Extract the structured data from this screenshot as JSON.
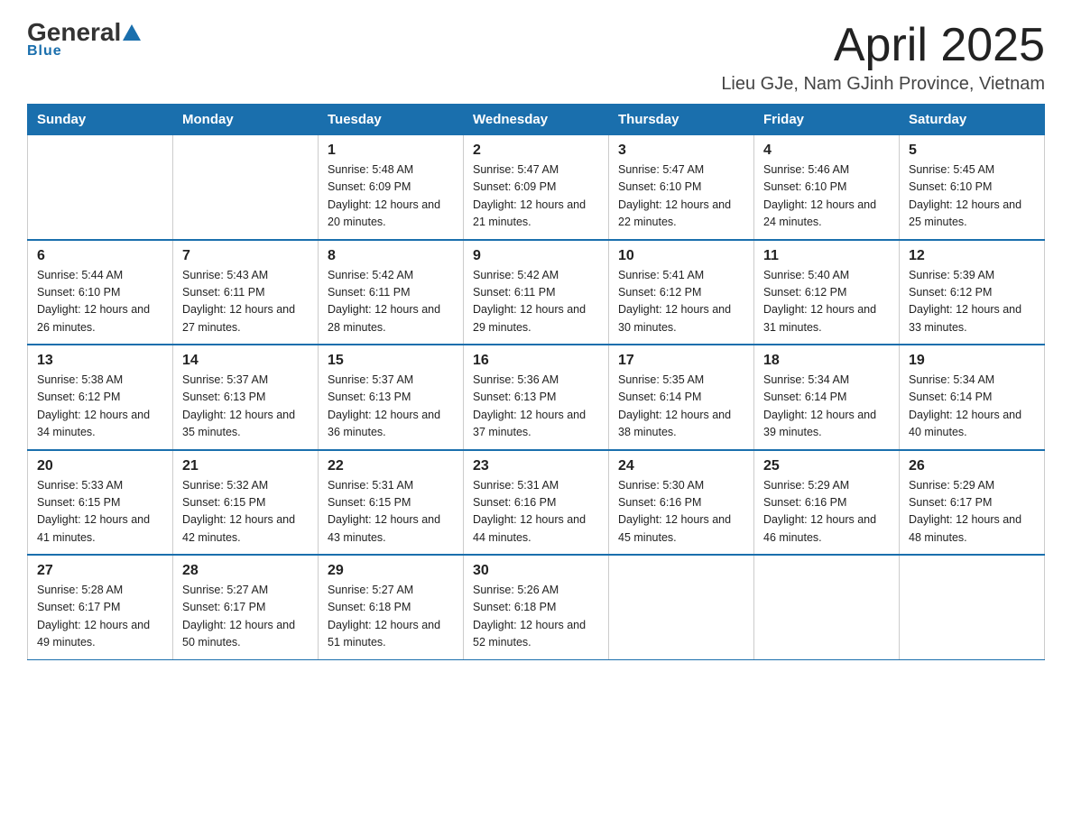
{
  "logo": {
    "general": "General",
    "blue": "Blue",
    "underline": "Blue"
  },
  "title": {
    "month_year": "April 2025",
    "location": "Lieu GJe, Nam GJinh Province, Vietnam"
  },
  "headers": [
    "Sunday",
    "Monday",
    "Tuesday",
    "Wednesday",
    "Thursday",
    "Friday",
    "Saturday"
  ],
  "weeks": [
    [
      {
        "day": "",
        "info": ""
      },
      {
        "day": "",
        "info": ""
      },
      {
        "day": "1",
        "info": "Sunrise: 5:48 AM\nSunset: 6:09 PM\nDaylight: 12 hours\nand 20 minutes."
      },
      {
        "day": "2",
        "info": "Sunrise: 5:47 AM\nSunset: 6:09 PM\nDaylight: 12 hours\nand 21 minutes."
      },
      {
        "day": "3",
        "info": "Sunrise: 5:47 AM\nSunset: 6:10 PM\nDaylight: 12 hours\nand 22 minutes."
      },
      {
        "day": "4",
        "info": "Sunrise: 5:46 AM\nSunset: 6:10 PM\nDaylight: 12 hours\nand 24 minutes."
      },
      {
        "day": "5",
        "info": "Sunrise: 5:45 AM\nSunset: 6:10 PM\nDaylight: 12 hours\nand 25 minutes."
      }
    ],
    [
      {
        "day": "6",
        "info": "Sunrise: 5:44 AM\nSunset: 6:10 PM\nDaylight: 12 hours\nand 26 minutes."
      },
      {
        "day": "7",
        "info": "Sunrise: 5:43 AM\nSunset: 6:11 PM\nDaylight: 12 hours\nand 27 minutes."
      },
      {
        "day": "8",
        "info": "Sunrise: 5:42 AM\nSunset: 6:11 PM\nDaylight: 12 hours\nand 28 minutes."
      },
      {
        "day": "9",
        "info": "Sunrise: 5:42 AM\nSunset: 6:11 PM\nDaylight: 12 hours\nand 29 minutes."
      },
      {
        "day": "10",
        "info": "Sunrise: 5:41 AM\nSunset: 6:12 PM\nDaylight: 12 hours\nand 30 minutes."
      },
      {
        "day": "11",
        "info": "Sunrise: 5:40 AM\nSunset: 6:12 PM\nDaylight: 12 hours\nand 31 minutes."
      },
      {
        "day": "12",
        "info": "Sunrise: 5:39 AM\nSunset: 6:12 PM\nDaylight: 12 hours\nand 33 minutes."
      }
    ],
    [
      {
        "day": "13",
        "info": "Sunrise: 5:38 AM\nSunset: 6:12 PM\nDaylight: 12 hours\nand 34 minutes."
      },
      {
        "day": "14",
        "info": "Sunrise: 5:37 AM\nSunset: 6:13 PM\nDaylight: 12 hours\nand 35 minutes."
      },
      {
        "day": "15",
        "info": "Sunrise: 5:37 AM\nSunset: 6:13 PM\nDaylight: 12 hours\nand 36 minutes."
      },
      {
        "day": "16",
        "info": "Sunrise: 5:36 AM\nSunset: 6:13 PM\nDaylight: 12 hours\nand 37 minutes."
      },
      {
        "day": "17",
        "info": "Sunrise: 5:35 AM\nSunset: 6:14 PM\nDaylight: 12 hours\nand 38 minutes."
      },
      {
        "day": "18",
        "info": "Sunrise: 5:34 AM\nSunset: 6:14 PM\nDaylight: 12 hours\nand 39 minutes."
      },
      {
        "day": "19",
        "info": "Sunrise: 5:34 AM\nSunset: 6:14 PM\nDaylight: 12 hours\nand 40 minutes."
      }
    ],
    [
      {
        "day": "20",
        "info": "Sunrise: 5:33 AM\nSunset: 6:15 PM\nDaylight: 12 hours\nand 41 minutes."
      },
      {
        "day": "21",
        "info": "Sunrise: 5:32 AM\nSunset: 6:15 PM\nDaylight: 12 hours\nand 42 minutes."
      },
      {
        "day": "22",
        "info": "Sunrise: 5:31 AM\nSunset: 6:15 PM\nDaylight: 12 hours\nand 43 minutes."
      },
      {
        "day": "23",
        "info": "Sunrise: 5:31 AM\nSunset: 6:16 PM\nDaylight: 12 hours\nand 44 minutes."
      },
      {
        "day": "24",
        "info": "Sunrise: 5:30 AM\nSunset: 6:16 PM\nDaylight: 12 hours\nand 45 minutes."
      },
      {
        "day": "25",
        "info": "Sunrise: 5:29 AM\nSunset: 6:16 PM\nDaylight: 12 hours\nand 46 minutes."
      },
      {
        "day": "26",
        "info": "Sunrise: 5:29 AM\nSunset: 6:17 PM\nDaylight: 12 hours\nand 48 minutes."
      }
    ],
    [
      {
        "day": "27",
        "info": "Sunrise: 5:28 AM\nSunset: 6:17 PM\nDaylight: 12 hours\nand 49 minutes."
      },
      {
        "day": "28",
        "info": "Sunrise: 5:27 AM\nSunset: 6:17 PM\nDaylight: 12 hours\nand 50 minutes."
      },
      {
        "day": "29",
        "info": "Sunrise: 5:27 AM\nSunset: 6:18 PM\nDaylight: 12 hours\nand 51 minutes."
      },
      {
        "day": "30",
        "info": "Sunrise: 5:26 AM\nSunset: 6:18 PM\nDaylight: 12 hours\nand 52 minutes."
      },
      {
        "day": "",
        "info": ""
      },
      {
        "day": "",
        "info": ""
      },
      {
        "day": "",
        "info": ""
      }
    ]
  ]
}
